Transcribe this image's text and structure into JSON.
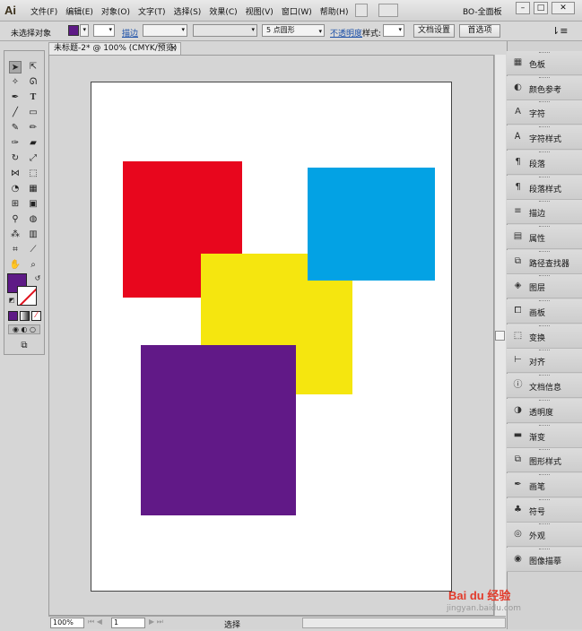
{
  "app": {
    "logo": "Ai",
    "workspace": "BO-全面板"
  },
  "menu": [
    "文件(F)",
    "编辑(E)",
    "对象(O)",
    "文字(T)",
    "选择(S)",
    "效果(C)",
    "视图(V)",
    "窗口(W)",
    "帮助(H)"
  ],
  "window_controls": {
    "minimize": "–",
    "maximize": "□",
    "close": "✕"
  },
  "control_bar": {
    "selection_status": "未选择对象",
    "stroke_link": "描边",
    "brush_value": "5 点圆形",
    "opacity_link": "不透明度",
    "style_label": "样式:",
    "doc_setup_button": "文档设置",
    "preferences_button": "首选项"
  },
  "document": {
    "tab_title": "未标题-2* @ 100% (CMYK/预览)",
    "tab_close": "×",
    "shapes": [
      {
        "name": "red-square",
        "color": "#e8061d"
      },
      {
        "name": "blue-square",
        "color": "#03a2e4"
      },
      {
        "name": "yellow-square",
        "color": "#f5e60f"
      },
      {
        "name": "purple-square",
        "color": "#611987"
      }
    ]
  },
  "status_bar": {
    "zoom": "100%",
    "page": "1",
    "tool": "选择"
  },
  "colors": {
    "fill": "#5e1a86",
    "stroke": "none"
  },
  "panels": [
    {
      "label": "色板",
      "icon": "swatches-icon"
    },
    {
      "label": "颜色参考",
      "icon": "color-guide-icon"
    },
    {
      "label": "字符",
      "icon": "character-icon"
    },
    {
      "label": "字符样式",
      "icon": "character-styles-icon"
    },
    {
      "label": "段落",
      "icon": "paragraph-icon"
    },
    {
      "label": "段落样式",
      "icon": "paragraph-styles-icon"
    },
    {
      "label": "描边",
      "icon": "stroke-icon"
    },
    {
      "label": "属性",
      "icon": "attributes-icon"
    },
    {
      "label": "路径查找器",
      "icon": "pathfinder-icon"
    },
    {
      "label": "图层",
      "icon": "layers-icon"
    },
    {
      "label": "画板",
      "icon": "artboards-icon"
    },
    {
      "label": "变换",
      "icon": "transform-icon"
    },
    {
      "label": "对齐",
      "icon": "align-icon"
    },
    {
      "label": "文档信息",
      "icon": "document-info-icon"
    },
    {
      "label": "透明度",
      "icon": "transparency-icon"
    },
    {
      "label": "渐变",
      "icon": "gradient-icon"
    },
    {
      "label": "图形样式",
      "icon": "graphic-styles-icon"
    },
    {
      "label": "画笔",
      "icon": "brushes-icon"
    },
    {
      "label": "符号",
      "icon": "symbols-icon"
    },
    {
      "label": "外观",
      "icon": "appearance-icon"
    },
    {
      "label": "图像描摹",
      "icon": "image-trace-icon"
    }
  ],
  "watermark": {
    "brand": "Bai du 经验",
    "url": "jingyan.baidu.com"
  }
}
